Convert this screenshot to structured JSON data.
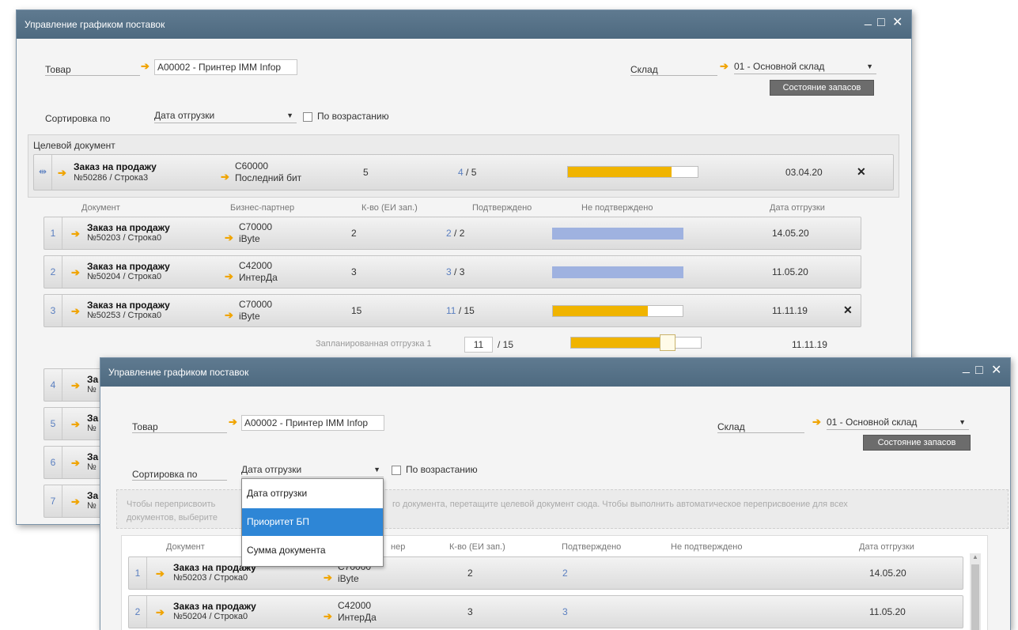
{
  "back": {
    "title": "Управление графиком поставок",
    "controls": {
      "min": "_",
      "max": "□",
      "close": "✕"
    },
    "item_label": "Товар",
    "item_value": "A00002 - Принтер IMM Infop",
    "warehouse_label": "Склад",
    "warehouse_value": "01 - Основной склад",
    "stock_button": "Состояние запасов",
    "sort_label": "Сортировка по",
    "sort_value": "Дата отгрузки",
    "ascending_label": "По возрастанию",
    "target_group": "Целевой документ",
    "target": {
      "type": "Заказ на продажу",
      "num": "№50286 / Строка3",
      "bp_code": "C60000",
      "bp_name": "Последний бит",
      "qty": "5",
      "confirmed": "4",
      "confirmed_total": "/ 5",
      "unconfirmed_fraction": 0.8,
      "date": "03.04.20"
    },
    "headers": {
      "document": "Документ",
      "partner": "Бизнес-партнер",
      "qty": "К-во (ЕИ зап.)",
      "confirmed": "Подтверждено",
      "unconfirmed": "Не подтверждено",
      "date": "Дата отгрузки"
    },
    "rows": [
      {
        "n": "1",
        "type": "Заказ на продажу",
        "num": "№50203 / Строка0",
        "bp_code": "C70000",
        "bp_name": "iByte",
        "qty": "2",
        "confirmed": "2",
        "confirmed_total": "/ 2",
        "date": "14.05.20"
      },
      {
        "n": "2",
        "type": "Заказ на продажу",
        "num": "№50204 / Строка0",
        "bp_code": "C42000",
        "bp_name": "ИнтерДа",
        "qty": "3",
        "confirmed": "3",
        "confirmed_total": "/ 3",
        "date": "11.05.20"
      },
      {
        "n": "3",
        "type": "Заказ на продажу",
        "num": "№50253 / Строка0",
        "bp_code": "C70000",
        "bp_name": "iByte",
        "qty": "15",
        "confirmed": "11",
        "confirmed_total": "/ 15",
        "date": "11.11.19"
      }
    ],
    "planned": {
      "label": "Запланированная отгрузка 1",
      "value": "11",
      "total": "/ 15",
      "date": "11.11.19"
    },
    "hidden_rows": [
      {
        "n": "4",
        "type": "За",
        "num": "№"
      },
      {
        "n": "5",
        "type": "За",
        "num": "№"
      },
      {
        "n": "6",
        "type": "За",
        "num": "№"
      },
      {
        "n": "7",
        "type": "За",
        "num": "№"
      }
    ]
  },
  "front": {
    "title": "Управление графиком поставок",
    "controls": {
      "min": "_",
      "max": "□",
      "close": "✕"
    },
    "item_label": "Товар",
    "item_value": "A00002 - Принтер IMM Infop",
    "warehouse_label": "Склад",
    "warehouse_value": "01 - Основной склад",
    "stock_button": "Состояние запасов",
    "sort_label": "Сортировка по",
    "sort_value": "Дата отгрузки",
    "ascending_label": "По возрастанию",
    "hint_line1_left": "Чтобы переприсвоить",
    "hint_line1_right": "го документа, перетащите целевой документ сюда. Чтобы выполнить автоматическое переприсвоение для всех",
    "hint_line2_left": "документов, выберите",
    "dropdown": [
      "Дата отгрузки",
      "Приоритет БП",
      "Сумма документа"
    ],
    "dropdown_selected": 1,
    "headers": {
      "document": "Документ",
      "partner_tail": "нер",
      "qty": "К-во (ЕИ зап.)",
      "confirmed": "Подтверждено",
      "unconfirmed": "Не подтверждено",
      "date": "Дата отгрузки"
    },
    "rows": [
      {
        "n": "1",
        "type": "Заказ на продажу",
        "num": "№50203 / Строка0",
        "bp_code": "C70000",
        "bp_name": "iByte",
        "qty": "2",
        "confirmed": "2",
        "date": "14.05.20"
      },
      {
        "n": "2",
        "type": "Заказ на продажу",
        "num": "№50204 / Строка0",
        "bp_code": "C42000",
        "bp_name": "ИнтерДа",
        "qty": "3",
        "confirmed": "3",
        "date": "11.05.20"
      }
    ]
  },
  "colors": {
    "confirmed_bar": "#f0b400",
    "full_bar": "#9fb2e0",
    "titlebar": "#56718a",
    "selection": "#2e86d6"
  }
}
